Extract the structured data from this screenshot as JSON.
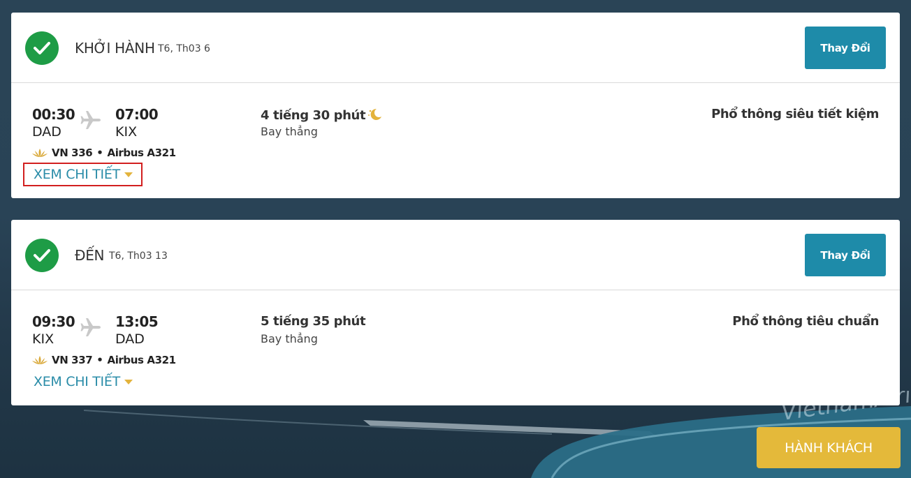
{
  "outbound": {
    "title": "KHỞI HÀNH",
    "date": "T6, Th03 6",
    "change_label": "Thay Đổi",
    "depart_time": "00:30",
    "depart_airport": "DAD",
    "arrive_time": "07:00",
    "arrive_airport": "KIX",
    "duration": "4 tiếng 30 phút",
    "stops": "Bay thẳng",
    "fare_class": "Phổ thông siêu tiết kiệm",
    "flight_no": "VN 336",
    "aircraft": "Airbus A321",
    "details_label": "XEM CHI TIẾT"
  },
  "inbound": {
    "title": "ĐẾN",
    "date": "T6, Th03 13",
    "change_label": "Thay Đổi",
    "depart_time": "09:30",
    "depart_airport": "KIX",
    "arrive_time": "13:05",
    "arrive_airport": "DAD",
    "duration": "5 tiếng 35 phút",
    "stops": "Bay thẳng",
    "fare_class": "Phổ thông tiêu chuẩn",
    "flight_no": "VN 337",
    "aircraft": "Airbus A321",
    "details_label": "XEM CHI TIẾT"
  },
  "passengers_label": "HÀNH KHÁCH",
  "background_brand": "VietnamAirlines",
  "icons": {
    "check": "check-circle-icon",
    "plane": "airplane-icon",
    "moon": "overnight-moon-icon",
    "lotus": "vietnam-airlines-lotus-icon",
    "caret": "caret-down-icon"
  },
  "colors": {
    "accent_blue": "#1e8ba9",
    "link_blue": "#2a8ca8",
    "check_green": "#1e9c46",
    "gold": "#e4b93a",
    "highlight_red": "#d21f1f"
  }
}
